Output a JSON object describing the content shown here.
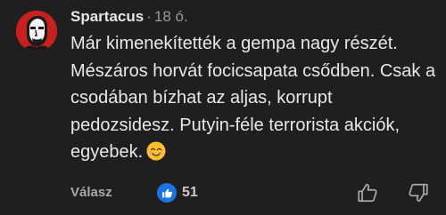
{
  "comment": {
    "author": "Spartacus",
    "separator": "·",
    "time": "18 ó.",
    "text": "Már kimenekítették a gempa nagy részét. Mészáros horvát focicsapata csődben. Csak a csodában bízhat az aljas, korrupt pedozsidesz. Putyin-féle terrorista akciók, egyebek.",
    "emoji": "smiling-face-emoji",
    "reply_label": "Válasz",
    "like_count": "51",
    "colors": {
      "background": "#1f1f1f",
      "avatar": "#c8201e",
      "like_badge": "#1b74e4"
    }
  }
}
